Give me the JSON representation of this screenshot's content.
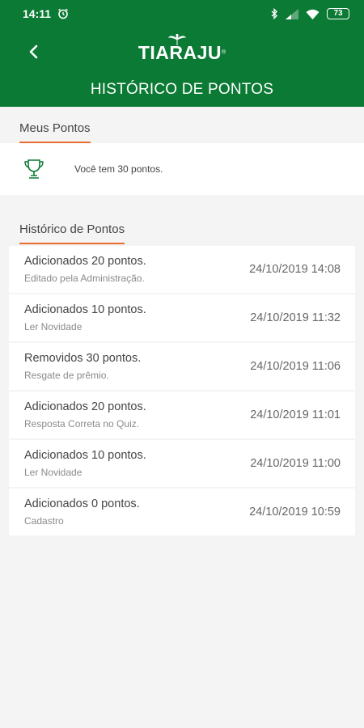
{
  "status": {
    "time": "14:11",
    "battery": "73"
  },
  "header": {
    "logo": "TIARAJU",
    "logo_reg": "®",
    "title": "HISTÓRICO DE PONTOS"
  },
  "my_points": {
    "section_title": "Meus Pontos",
    "text": "Você tem 30 pontos."
  },
  "history": {
    "section_title": "Histórico de Pontos",
    "items": [
      {
        "title": "Adicionados 20 pontos.",
        "subtitle": "Editado pela Administração.",
        "date": "24/10/2019 14:08"
      },
      {
        "title": "Adicionados 10 pontos.",
        "subtitle": "Ler Novidade",
        "date": "24/10/2019 11:32"
      },
      {
        "title": "Removidos 30 pontos.",
        "subtitle": "Resgate de prêmio.",
        "date": "24/10/2019 11:06"
      },
      {
        "title": "Adicionados 20 pontos.",
        "subtitle": "Resposta Correta no Quiz.",
        "date": "24/10/2019 11:01"
      },
      {
        "title": "Adicionados 10 pontos.",
        "subtitle": "Ler Novidade",
        "date": "24/10/2019 11:00"
      },
      {
        "title": "Adicionados 0 pontos.",
        "subtitle": "Cadastro",
        "date": "24/10/2019 10:59"
      }
    ]
  },
  "colors": {
    "primary": "#0b7a34",
    "accent": "#e86c2e",
    "background": "#f4f4f4"
  }
}
